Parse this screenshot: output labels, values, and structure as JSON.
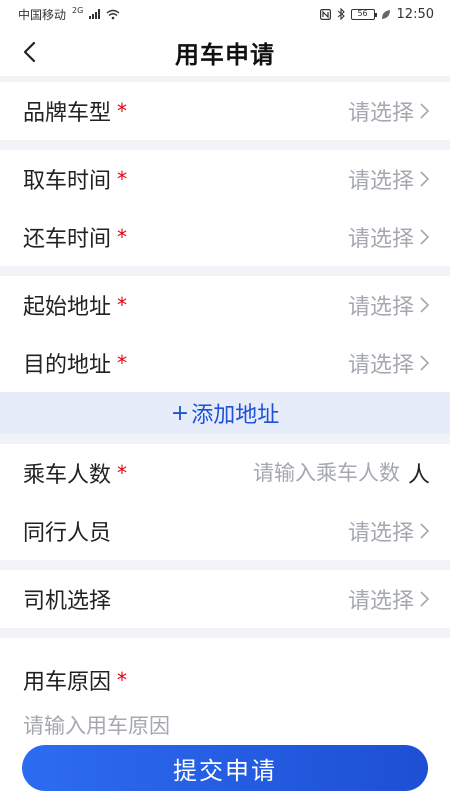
{
  "status_bar": {
    "carrier": "中国移动",
    "network": "2G",
    "battery": "56",
    "time": "12:50"
  },
  "nav": {
    "title": "用车申请",
    "back_icon": "chevron-left-icon"
  },
  "form": {
    "required_mark": "*",
    "select_placeholder": "请选择",
    "vehicle_model": {
      "label": "品牌车型",
      "value": "请选择"
    },
    "pickup_time": {
      "label": "取车时间",
      "value": "请选择"
    },
    "return_time": {
      "label": "还车时间",
      "value": "请选择"
    },
    "start_address": {
      "label": "起始地址",
      "value": "请选择"
    },
    "destination": {
      "label": "目的地址",
      "value": "请选择"
    },
    "add_address": {
      "plus": "+",
      "label": "添加地址"
    },
    "passenger_count": {
      "label": "乘车人数",
      "value": "",
      "placeholder": "请输入乘车人数",
      "unit": "人"
    },
    "companions": {
      "label": "同行人员",
      "value": "请选择"
    },
    "driver": {
      "label": "司机选择",
      "value": "请选择"
    },
    "reason": {
      "label": "用车原因",
      "value": "",
      "placeholder": "请输入用车原因"
    }
  },
  "submit": {
    "label": "提交申请"
  },
  "colors": {
    "accent": "#1e52d6",
    "required": "#e60012",
    "placeholder": "#a5a8b0",
    "background": "#f2f3f7"
  }
}
